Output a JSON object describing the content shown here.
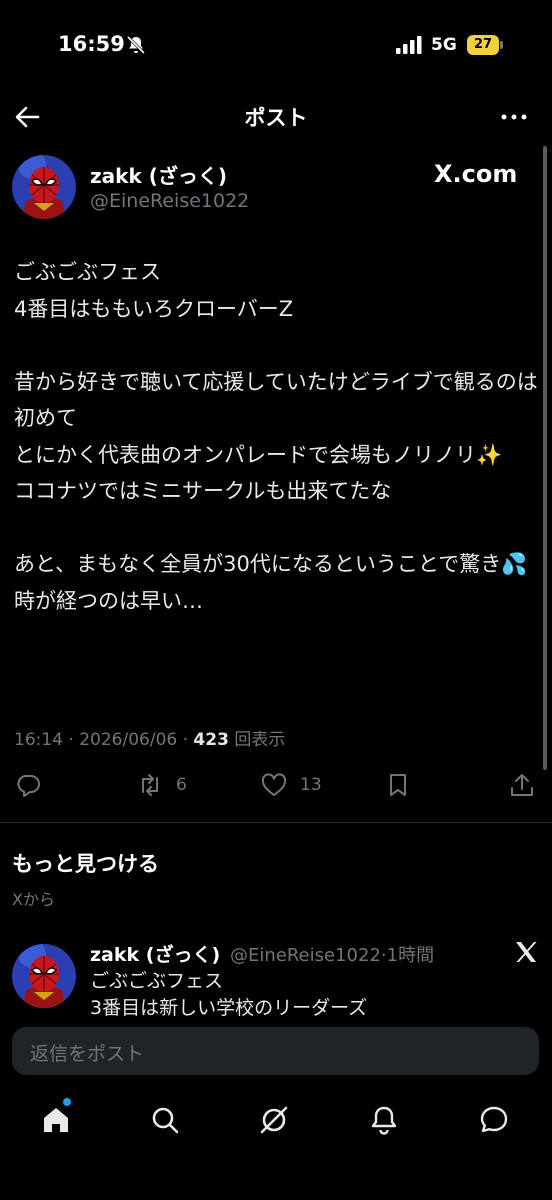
{
  "status_bar": {
    "time": "16:59",
    "network": "5G",
    "battery": "27"
  },
  "header": {
    "title": "ポスト"
  },
  "author": {
    "name": "zakk (ざっく)",
    "handle": "@EineReise1022",
    "source_badge": "X.com"
  },
  "post": {
    "text": "ごぶごぶフェス\n4番目はももいろクローバーZ\n\n昔から好きで聴いて応援していたけどライブで観るのは初めて\nとにかく代表曲のオンパレードで会場もノリノリ✨\nココナツではミニサークルも出来てたな\n\nあと、まもなく全員が30代になるということで驚き💦\n時が経つのは早い…",
    "time": "16:14",
    "date": "2026/06/06",
    "views": "423",
    "views_label": "回表示"
  },
  "actions": {
    "reposts": "6",
    "likes": "13"
  },
  "discover": {
    "title": "もっと見つける",
    "subtitle": "Xから"
  },
  "recommended": {
    "name": "zakk (ざっく)",
    "handle_time": "@EineReise1022·1時間",
    "text": "ごぶごぶフェス\n3番目は新しい学校のリーダーズ"
  },
  "reply": {
    "placeholder": "返信をポスト"
  },
  "icons": {
    "back": "arrow-left-icon",
    "more": "more-horizontal-icon",
    "reply": "reply-icon",
    "repost": "repost-icon",
    "like": "heart-icon",
    "bookmark": "bookmark-icon",
    "share": "share-icon",
    "nav": [
      "home-icon",
      "search-icon",
      "grok-icon",
      "bell-icon",
      "messages-icon"
    ]
  },
  "colors": {
    "accent": "#1d9bf0",
    "muted": "#71767b",
    "text": "#e7e9ea",
    "battery": "#f4d03f"
  }
}
